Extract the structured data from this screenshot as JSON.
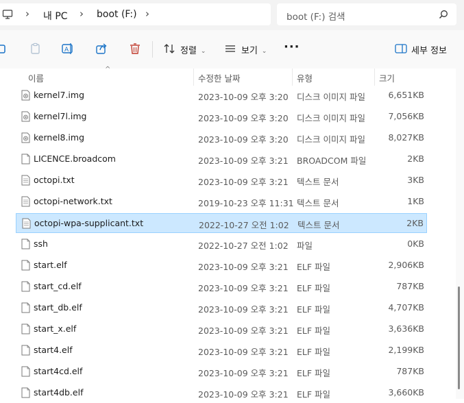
{
  "address": {
    "crumbs": [
      "내 PC",
      "boot (F:)"
    ]
  },
  "search": {
    "placeholder": "boot (F:) 검색"
  },
  "toolbar": {
    "sort_label": "정렬",
    "view_label": "보기",
    "details_label": "세부 정보"
  },
  "columns": {
    "name": "이름",
    "date": "수정한 날짜",
    "type": "유형",
    "size": "크기"
  },
  "files": [
    {
      "name": "kernel7.img",
      "date": "2023-10-09 오후 3:20",
      "type": "디스크 이미지 파일",
      "size": "6,651KB",
      "icon": "disk-image",
      "selected": false
    },
    {
      "name": "kernel7l.img",
      "date": "2023-10-09 오후 3:20",
      "type": "디스크 이미지 파일",
      "size": "7,056KB",
      "icon": "disk-image",
      "selected": false
    },
    {
      "name": "kernel8.img",
      "date": "2023-10-09 오후 3:20",
      "type": "디스크 이미지 파일",
      "size": "8,027KB",
      "icon": "disk-image",
      "selected": false
    },
    {
      "name": "LICENCE.broadcom",
      "date": "2023-10-09 오후 3:21",
      "type": "BROADCOM 파일",
      "size": "2KB",
      "icon": "file",
      "selected": false
    },
    {
      "name": "octopi.txt",
      "date": "2023-10-09 오후 3:21",
      "type": "텍스트 문서",
      "size": "3KB",
      "icon": "text",
      "selected": false
    },
    {
      "name": "octopi-network.txt",
      "date": "2019-10-23 오후 11:31",
      "type": "텍스트 문서",
      "size": "1KB",
      "icon": "text",
      "selected": false
    },
    {
      "name": "octopi-wpa-supplicant.txt",
      "date": "2022-10-27 오전 1:02",
      "type": "텍스트 문서",
      "size": "2KB",
      "icon": "text",
      "selected": true
    },
    {
      "name": "ssh",
      "date": "2022-10-27 오전 1:02",
      "type": "파일",
      "size": "0KB",
      "icon": "file",
      "selected": false
    },
    {
      "name": "start.elf",
      "date": "2023-10-09 오후 3:21",
      "type": "ELF 파일",
      "size": "2,906KB",
      "icon": "file",
      "selected": false
    },
    {
      "name": "start_cd.elf",
      "date": "2023-10-09 오후 3:21",
      "type": "ELF 파일",
      "size": "787KB",
      "icon": "file",
      "selected": false
    },
    {
      "name": "start_db.elf",
      "date": "2023-10-09 오후 3:21",
      "type": "ELF 파일",
      "size": "4,707KB",
      "icon": "file",
      "selected": false
    },
    {
      "name": "start_x.elf",
      "date": "2023-10-09 오후 3:21",
      "type": "ELF 파일",
      "size": "3,636KB",
      "icon": "file",
      "selected": false
    },
    {
      "name": "start4.elf",
      "date": "2023-10-09 오후 3:21",
      "type": "ELF 파일",
      "size": "2,199KB",
      "icon": "file",
      "selected": false
    },
    {
      "name": "start4cd.elf",
      "date": "2023-10-09 오후 3:21",
      "type": "ELF 파일",
      "size": "787KB",
      "icon": "file",
      "selected": false
    },
    {
      "name": "start4db.elf",
      "date": "2023-10-09 오후 3:21",
      "type": "ELF 파일",
      "size": "3,660KB",
      "icon": "file",
      "selected": false
    }
  ]
}
